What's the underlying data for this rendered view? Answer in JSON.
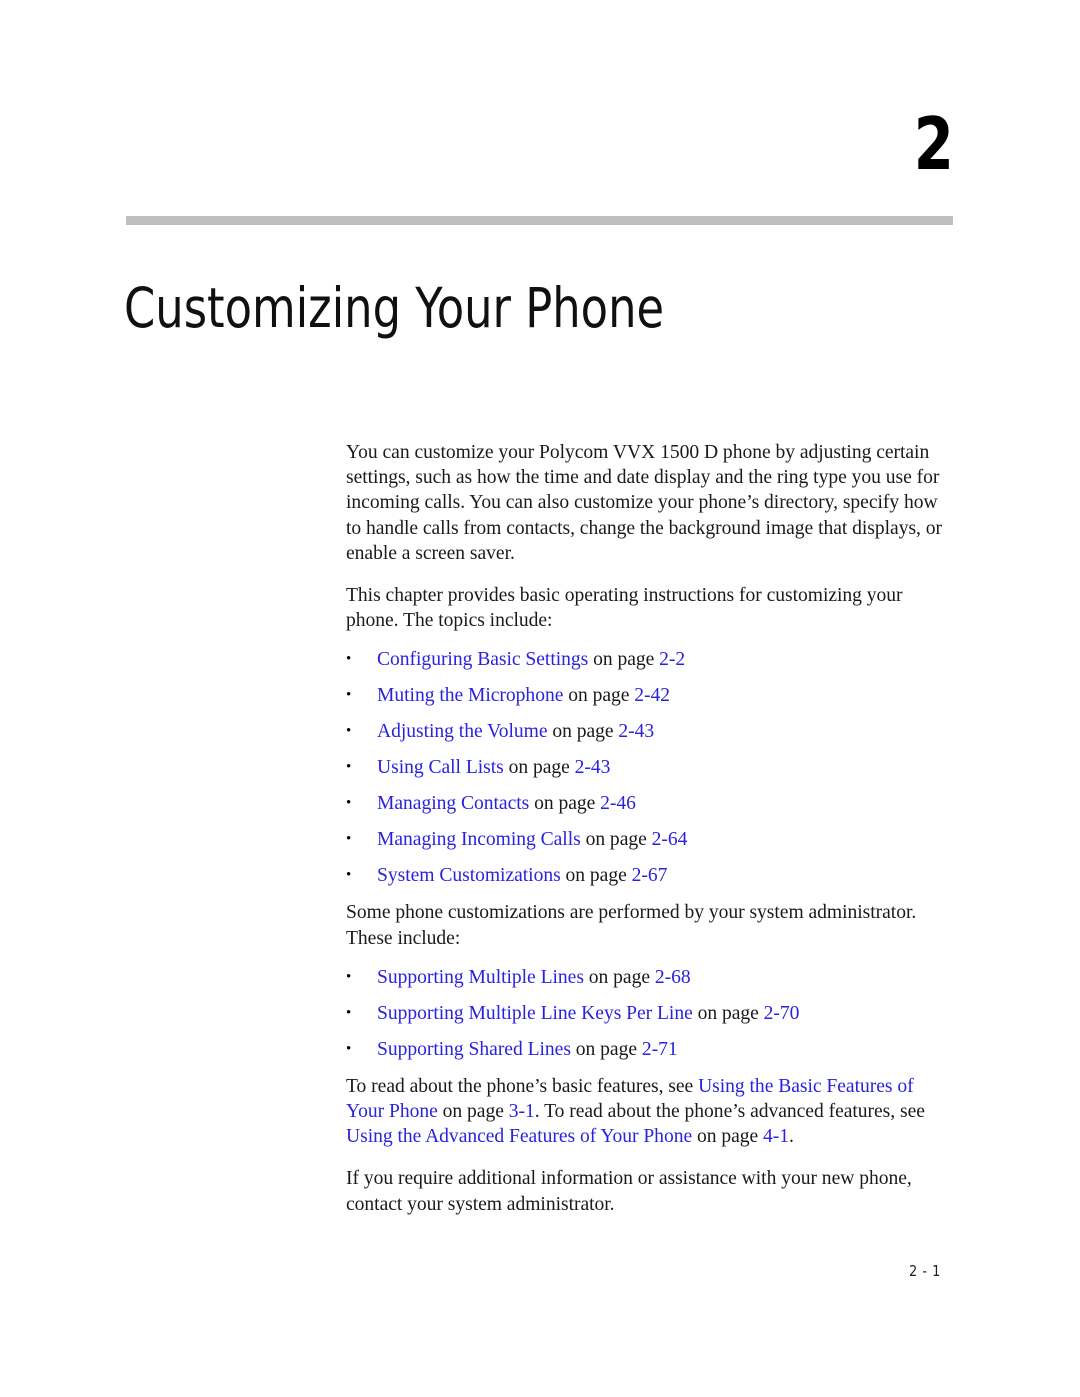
{
  "chapter": {
    "number": "2",
    "title": "Customizing Your Phone"
  },
  "intro": {
    "paragraph_1": "You can customize your Polycom VVX 1500 D phone by adjusting certain settings, such as how the time and date display and the ring type you use for incoming calls. You can also customize your phone’s directory, specify how to handle calls from contacts, change the background image that displays, or enable a screen saver.",
    "paragraph_2": "This chapter provides basic operating instructions for customizing your phone. The topics include:"
  },
  "topics": [
    {
      "link": "Configuring Basic Settings",
      "connector": "on page",
      "page": "2-2"
    },
    {
      "link": "Muting the Microphone",
      "connector": "on page",
      "page": "2-42"
    },
    {
      "link": "Adjusting the Volume",
      "connector": "on page",
      "page": "2-43"
    },
    {
      "link": "Using Call Lists",
      "connector": "on page",
      "page": "2-43"
    },
    {
      "link": "Managing Contacts",
      "connector": "on page",
      "page": "2-46"
    },
    {
      "link": "Managing Incoming Calls",
      "connector": "on page",
      "page": "2-64"
    },
    {
      "link": "System Customizations",
      "connector": "on page",
      "page": "2-67"
    }
  ],
  "admin": {
    "intro": "Some phone customizations are performed by your system administrator. These include:",
    "topics": [
      {
        "link": "Supporting Multiple Lines",
        "connector": "on page",
        "page": "2-68"
      },
      {
        "link": "Supporting Multiple Line Keys Per Line",
        "connector": "on page",
        "page": "2-70"
      },
      {
        "link": "Supporting Shared Lines",
        "connector": "on page",
        "page": "2-71"
      }
    ]
  },
  "cross_reference": {
    "seg_1": "To read about the phone’s basic features, see ",
    "link_1": "Using the Basic Features of Your Phone",
    "seg_2": " on page ",
    "page_1": "3-1",
    "seg_3": ". To read about the phone’s advanced features, see ",
    "link_2": "Using the Advanced Features of Your Phone",
    "seg_4": " on page ",
    "page_2": "4-1",
    "seg_5": "."
  },
  "closing": {
    "paragraph": "If you require additional information or assistance with your new phone, contact your system administrator."
  },
  "footer": {
    "page_label": "2 - 1"
  },
  "colors": {
    "link": "#2a22df",
    "rule": "#bfbfbf",
    "text": "#1a1a1a"
  }
}
